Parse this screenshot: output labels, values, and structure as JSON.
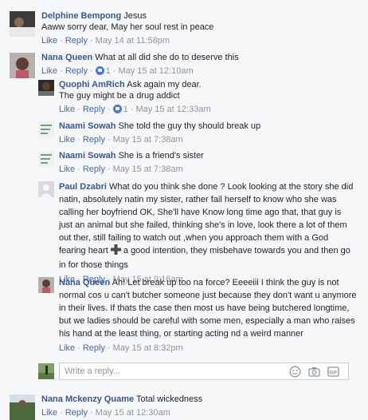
{
  "actions": {
    "like": "Like",
    "reply": "Reply",
    "sep": "·"
  },
  "comments": [
    {
      "author": "Delphine Bempong",
      "text": "Jesus",
      "text2": "Aaww sorry dear, May her soul rest in peace",
      "reactions": "",
      "time": "May 14 at 11:58pm"
    },
    {
      "author": "Nana Queen",
      "text": "What at all did she do to deserve this",
      "reactions": "1",
      "time": "May 15 at 12:10am"
    },
    {
      "author": "Quophi AmRich",
      "text": "Ask again my dear.",
      "text2": "The guy might be a drug addict",
      "reactions": "1",
      "time": "May 15 at 12:33am"
    },
    {
      "author": "Naami Sowah",
      "text": "She told the guy thy should break up",
      "time": "May 15 at 7:38am"
    },
    {
      "author": "Naami Sowah",
      "text": "She is a friend's sister",
      "time": "May 15 at 7:38am"
    },
    {
      "author": "Paul Dzabri",
      "text": "What do you think she done ? Look looking at the story she did natin, absolutely natin my sister, rather fail herself to know who she was calling her boyfriend OK, She'll have Know long time ago that, that guy is just an animal but she failed, thinking she's in love, look there a lot of them out ther, still failing to watch out ,when you approach them with a God fearing heart",
      "text_after": "a good intention, they misbehave towards you and then go in for those things",
      "time": "May 15 at 9:16am"
    },
    {
      "author": "Nana Queen",
      "text": "Ah! Let break up too na force? Eeeeiii I think the guy is not normal cos u can't butcher someone just because they don't want u anymore in their lives. If thats the case then most us have being butchered longtime, but we ladies should be careful with some men, especially a man who raises his hand at the least thing, or starting acting nd a weird manner",
      "time": "May 15 at 8:32pm"
    },
    {
      "author": "Nana Mckenzy Quame",
      "text": "Total wickedness",
      "time": "May 15 at 12:30am"
    }
  ],
  "reply_box": {
    "placeholder": "Write a reply..."
  },
  "colors": {
    "link": "#365899",
    "action": "#4267b2",
    "meta": "#90949c",
    "like": "#4a78d6"
  }
}
